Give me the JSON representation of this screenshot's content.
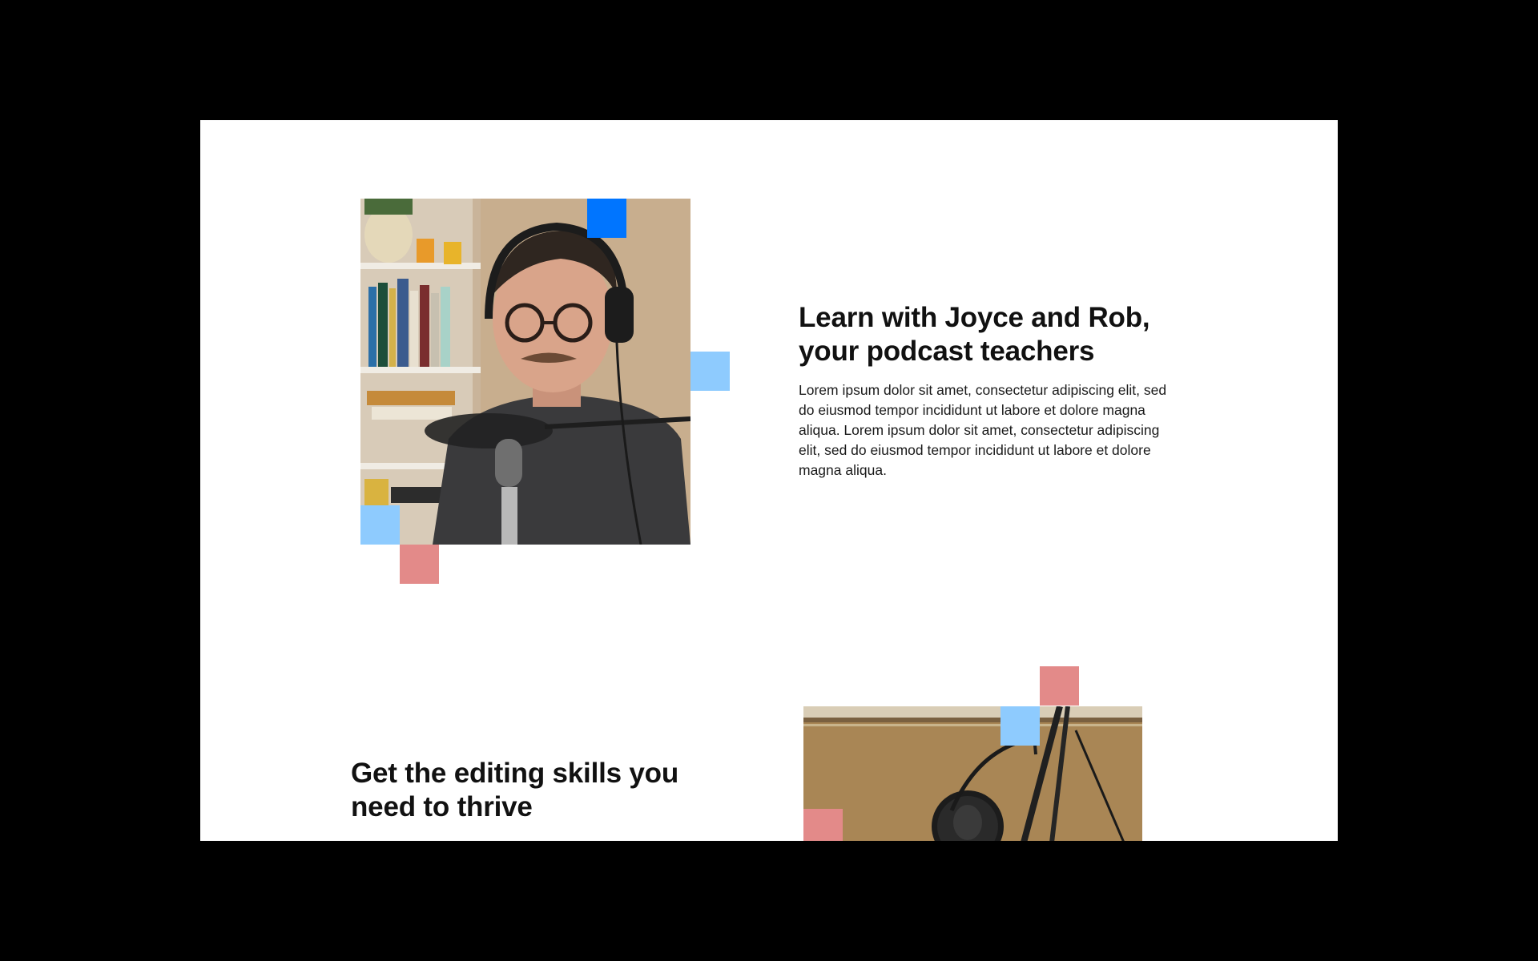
{
  "section1": {
    "heading_line1": "Learn with Joyce and Rob,",
    "heading_line2": "your podcast teachers",
    "body": "Lorem ipsum dolor sit amet, consectetur adipiscing elit, sed do eiusmod tempor incididunt ut labore et dolore magna aliqua. Lorem ipsum dolor sit amet, consectetur adipiscing elit, sed do eiusmod tempor incididunt ut labore et dolore magna aliqua."
  },
  "section2": {
    "heading_line1": "Get the editing skills you",
    "heading_line2": "need to thrive"
  },
  "colors": {
    "accent_blue": "#0075ff",
    "light_blue": "#8ecbfe",
    "salmon": "#e38a89",
    "background": "#ffffff",
    "frame": "#000000"
  },
  "icons": {
    "photo1": "podcaster-headphones-photo",
    "photo2": "microphone-stand-photo"
  }
}
